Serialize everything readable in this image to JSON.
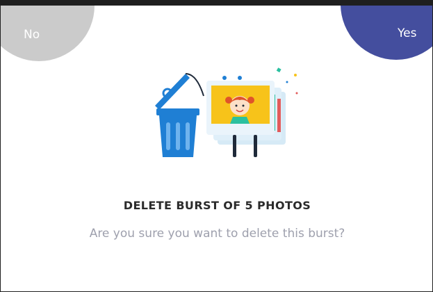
{
  "dialog": {
    "no_label": "No",
    "yes_label": "Yes",
    "title": "DELETE BURST OF 5 PHOTOS",
    "message": "Are you sure you want to delete this burst?"
  },
  "colors": {
    "no_button": "#cbcbcb",
    "yes_button": "#444e9e",
    "trash_blue": "#1f7fd4",
    "photo_yellow": "#f7c31a"
  },
  "icons": [
    "trash-can-icon",
    "photo-stack-icon"
  ]
}
